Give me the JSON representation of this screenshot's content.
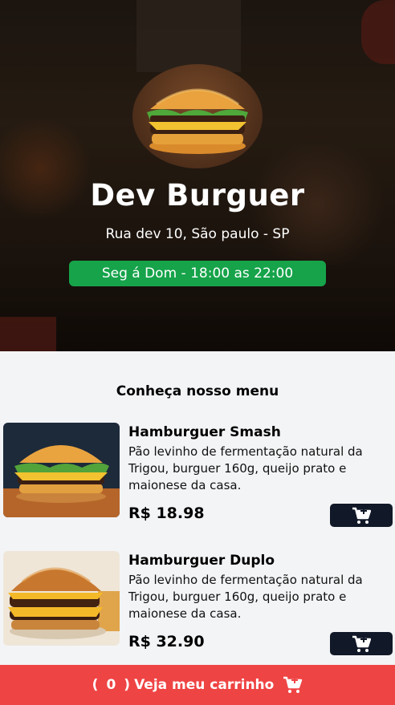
{
  "header": {
    "title": "Dev Burguer",
    "address": "Rua dev 10, São paulo - SP",
    "hours": "Seg á Dom - 18:00 as 22:00"
  },
  "menu": {
    "heading": "Conheça nosso menu",
    "items": [
      {
        "name": "Hamburguer Smash",
        "description": "Pão levinho de fermentação natural da Trigou, burguer 160g, queijo prato e maionese da casa.",
        "price": "R$ 18.98",
        "add_icon": "cart-plus-icon"
      },
      {
        "name": "Hamburguer Duplo",
        "description": "Pão levinho de fermentação natural da Trigou, burguer 160g, queijo prato e maionese da casa.",
        "price": "R$ 32.90",
        "add_icon": "cart-plus-icon"
      }
    ]
  },
  "cart": {
    "open_paren": "(",
    "count": "0",
    "close_paren": ")",
    "label": "Veja meu carrinho",
    "icon": "cart-plus-icon"
  },
  "colors": {
    "accent_green": "#16a34a",
    "button_dark": "#111827",
    "cart_red": "#ef4444",
    "background": "#f3f4f6"
  }
}
